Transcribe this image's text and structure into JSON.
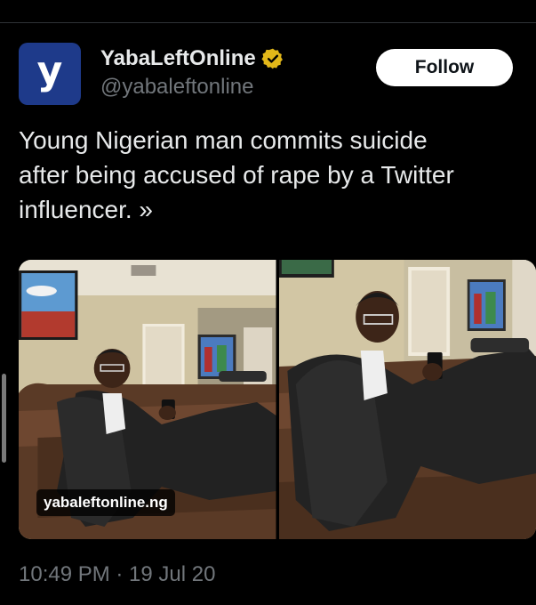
{
  "tweet": {
    "author": {
      "display_name": "YabaLeftOnline",
      "handle": "@yabaleftonline",
      "avatar_letter": "y",
      "avatar_color": "#1e3a8a",
      "verified_badge_color": "#e2b719",
      "verified_icon": "verified-badge-icon"
    },
    "follow_label": "Follow",
    "text": "Young Nigerian man commits suicide\nafter being accused of rape by a Twitter\ninfluencer. »",
    "media": {
      "watermark": "yabaleftonline.ng",
      "photo_count": 2
    },
    "timestamp": "10:49 PM · 19 Jul 20"
  },
  "colors": {
    "background": "#000000",
    "primary_text": "#e7e9ea",
    "secondary_text": "#71767b",
    "follow_button_bg": "#ffffff",
    "follow_button_text": "#0f1419"
  }
}
